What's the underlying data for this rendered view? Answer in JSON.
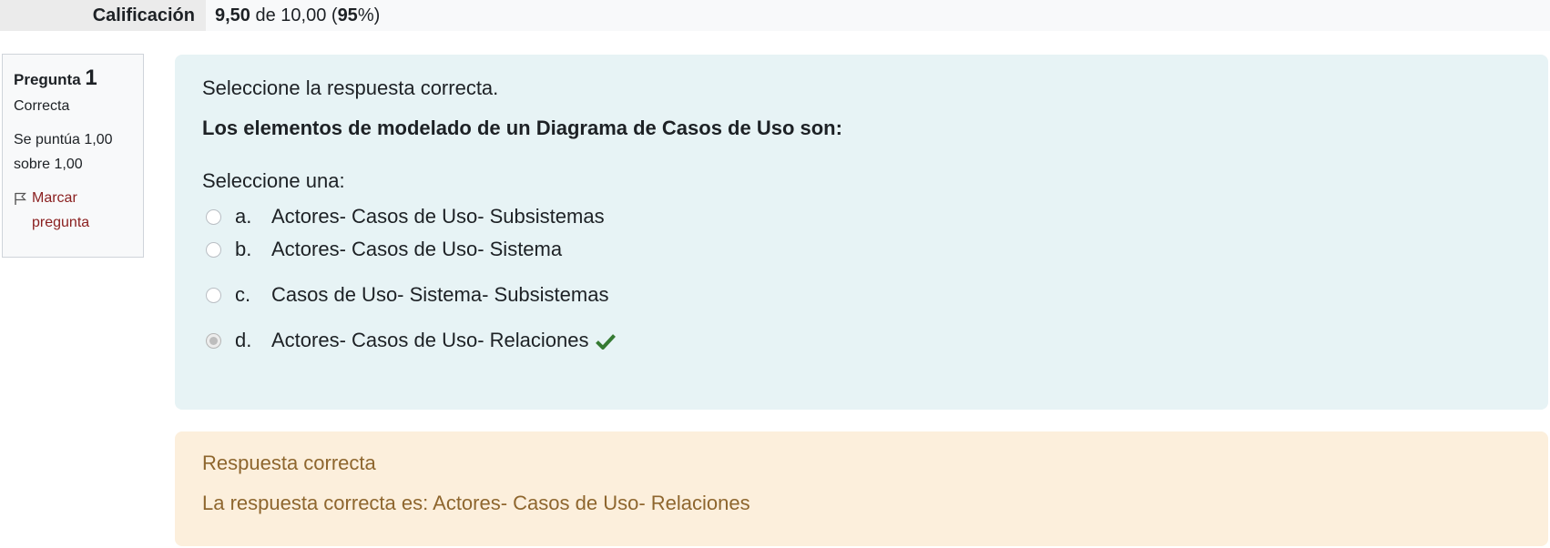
{
  "grade_summary": {
    "label": "Calificación",
    "score": "9,50",
    "of_text": " de 10,00 (",
    "percent": "95",
    "suffix": "%)"
  },
  "question_info": {
    "question_label": "Pregunta",
    "question_number": "1",
    "state": "Correcta",
    "grade_text": "Se puntúa 1,00 sobre 1,00",
    "flag_label": "Marcar pregunta"
  },
  "question": {
    "instruction": "Seleccione la respuesta correcta.",
    "text": "Los elementos de modelado de un Diagrama de Casos de Uso son:",
    "prompt": "Seleccione una:",
    "options": [
      {
        "letter": "a.",
        "text": "Actores- Casos de Uso- Subsistemas",
        "selected": false
      },
      {
        "letter": "b.",
        "text": "Actores- Casos de Uso- Sistema",
        "selected": false
      },
      {
        "letter": "c.",
        "text": "Casos de Uso- Sistema- Subsistemas",
        "selected": false
      },
      {
        "letter": "d.",
        "text": "Actores- Casos de Uso- Relaciones",
        "selected": true,
        "icon": "check-icon"
      }
    ]
  },
  "feedback": {
    "result": "Respuesta correcta",
    "right_answer": "La respuesta correcta es: Actores- Casos de Uso- Relaciones"
  },
  "colors": {
    "question_bg": "#e7f3f5",
    "feedback_bg": "#fcefdc",
    "feedback_text": "#8e662e",
    "flag_link": "#8a1f1f",
    "check": "#357a32"
  }
}
